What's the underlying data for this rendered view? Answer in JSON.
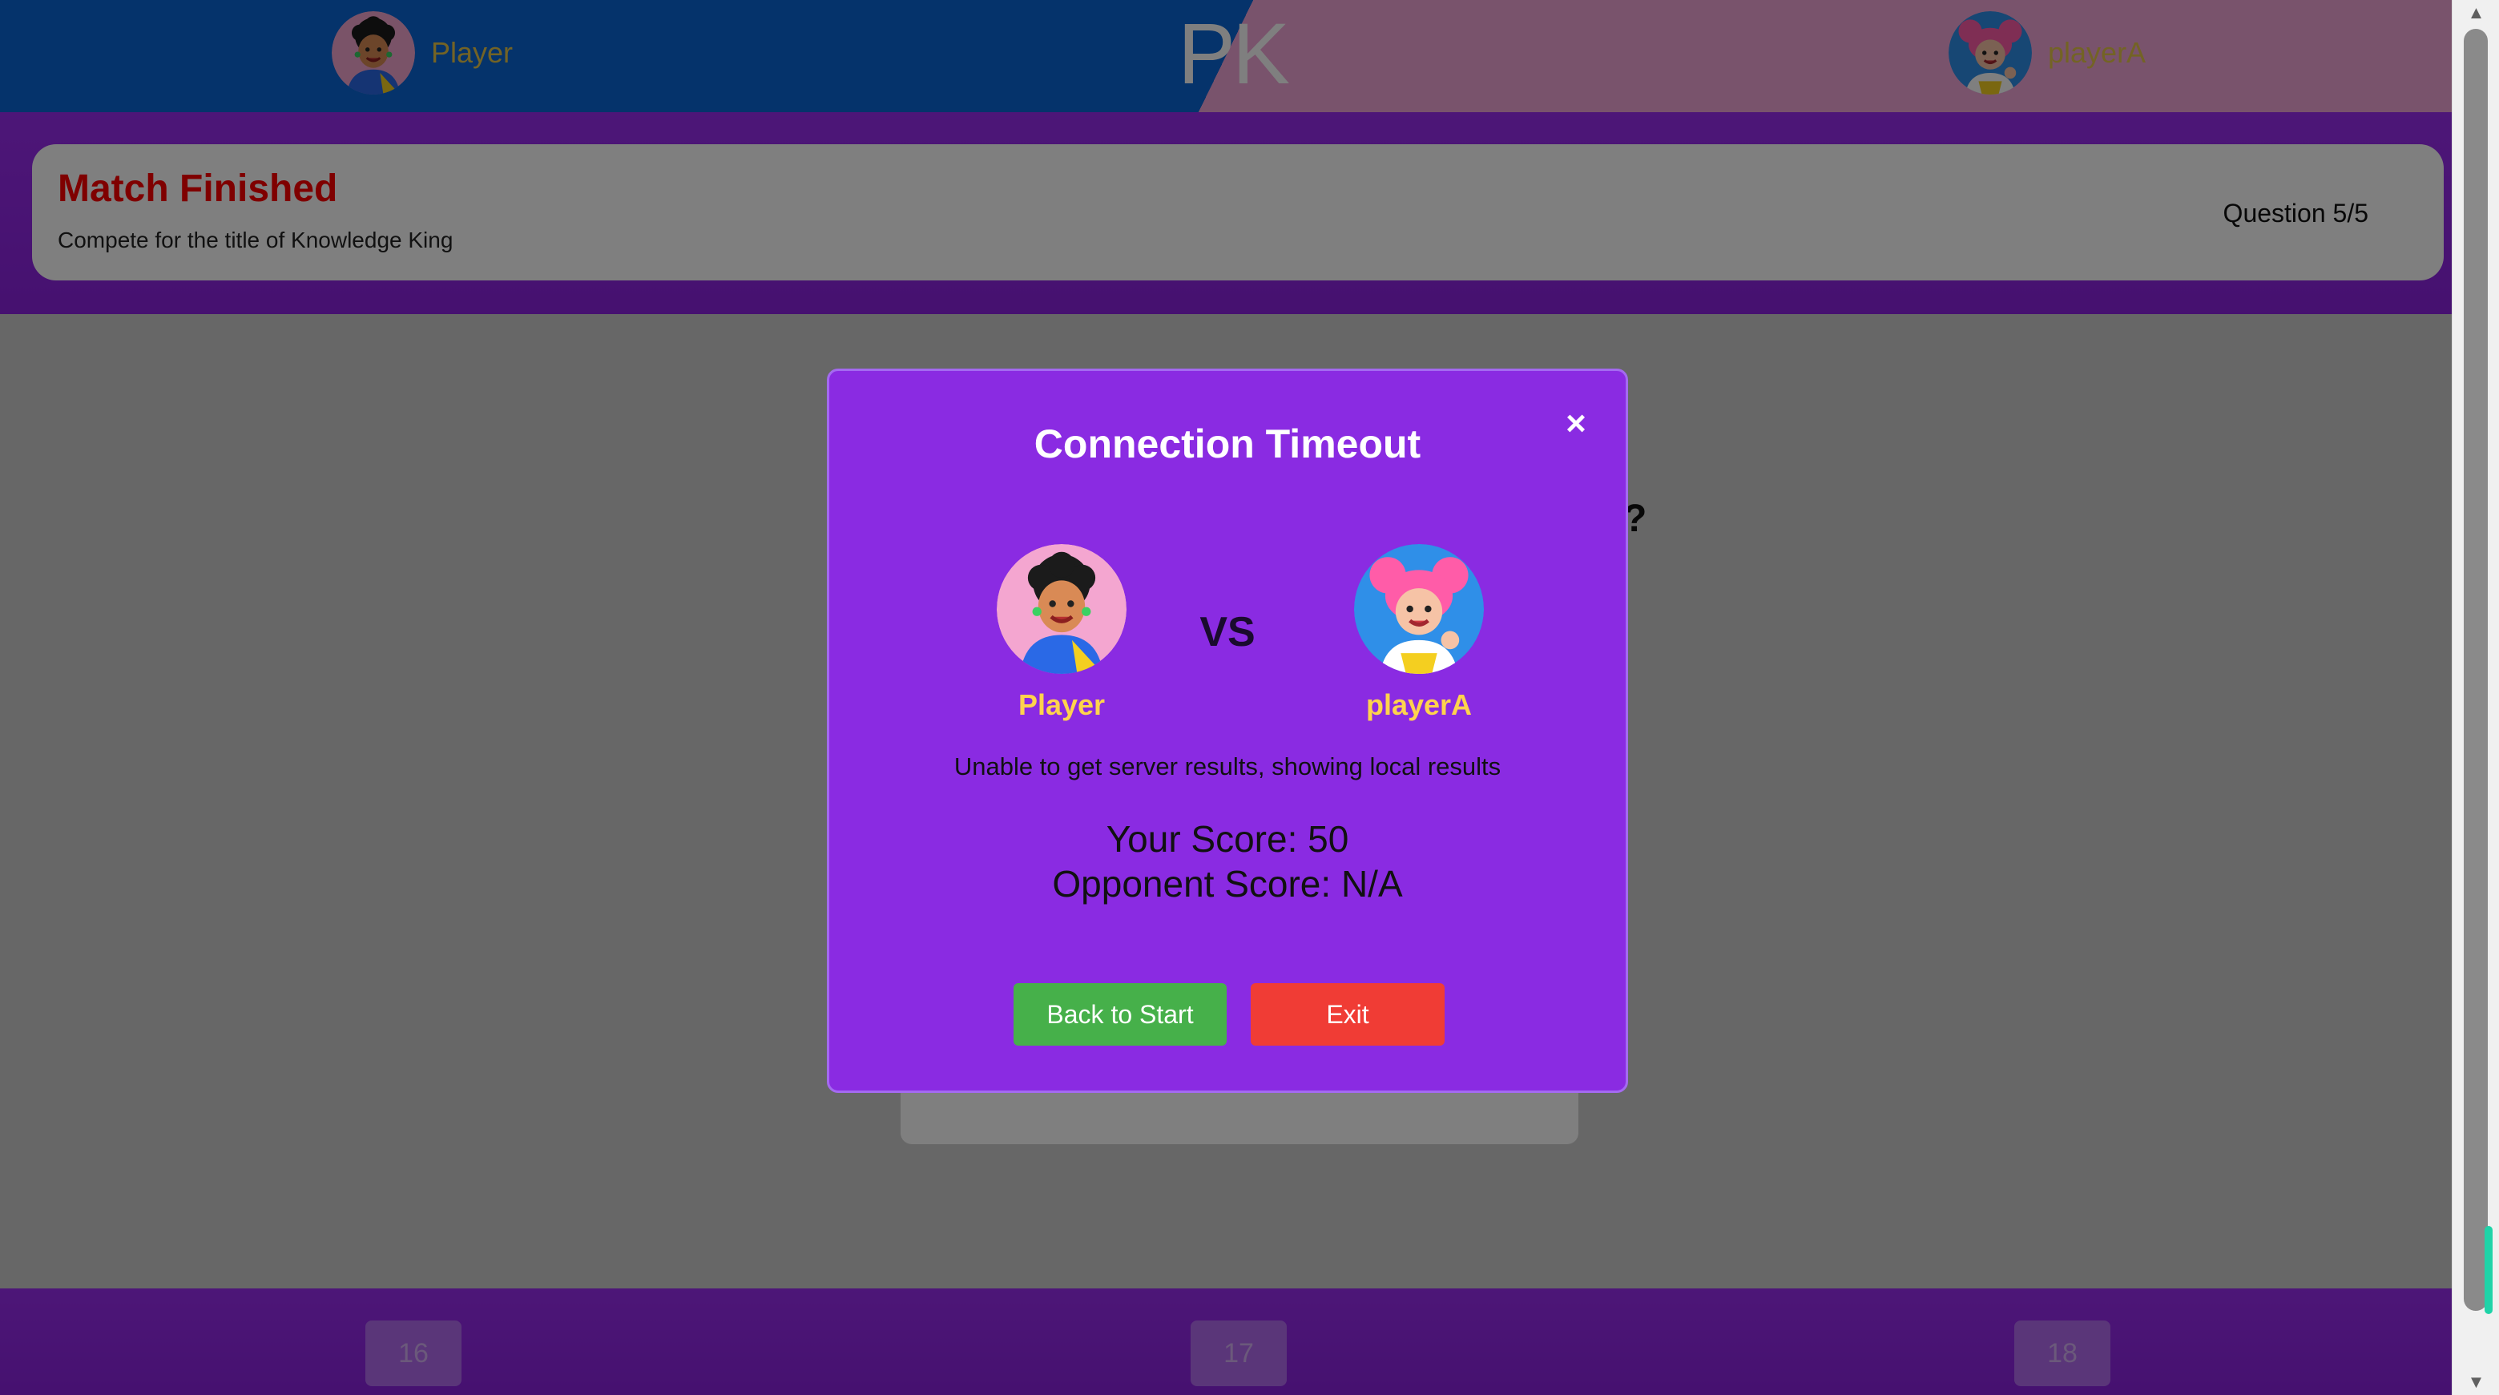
{
  "topbar": {
    "left_player": "Player",
    "right_player": "playerA",
    "center_label": "PK",
    "left_color": "#0a66d6",
    "right_color": "#f3a7d9"
  },
  "header": {
    "title": "Match Finished",
    "subtitle": "Compete for the title of Knowledge King",
    "question_counter": "Question 5/5"
  },
  "game": {
    "question_suffix": "?"
  },
  "bottombar": {
    "levels": [
      "16",
      "17",
      "18"
    ]
  },
  "modal": {
    "title": "Connection Timeout",
    "close_icon": "×",
    "player_name": "Player",
    "vs_label": "VS",
    "opponent_name": "playerA",
    "message": "Unable to get server results, showing local results",
    "your_score": "Your Score: 50",
    "opponent_score": "Opponent Score: N/A",
    "back_label": "Back to Start",
    "exit_label": "Exit"
  },
  "colors": {
    "purple": "#8a2be2",
    "title_red": "#ff0000",
    "name_yellow": "#ffd34d",
    "back_green": "#46b04a",
    "exit_red": "#f03c35"
  },
  "icons": {
    "scroll_up": "▲",
    "scroll_down": "▼"
  }
}
